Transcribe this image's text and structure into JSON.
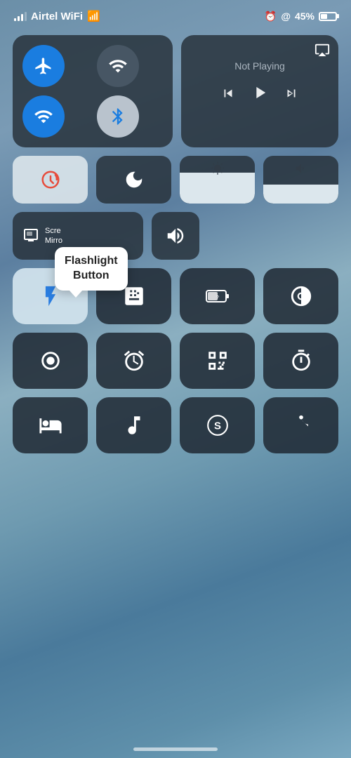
{
  "statusBar": {
    "carrier": "Airtel WiFi",
    "battery": "45%",
    "alarmIcon": "⏰",
    "locationIcon": "@"
  },
  "connectivity": {
    "airplane": {
      "active": true,
      "label": "Airplane Mode"
    },
    "cellular": {
      "active": false,
      "label": "Cellular Data"
    },
    "wifi": {
      "active": true,
      "label": "Wi-Fi"
    },
    "bluetooth": {
      "active": false,
      "label": "Bluetooth"
    }
  },
  "nowPlaying": {
    "title": "Not Playing",
    "airplayLabel": "AirPlay"
  },
  "mediaControls": {
    "previous": "⏮",
    "play": "▶",
    "next": "⏭"
  },
  "utilityRow": {
    "screenLock": "Screen Lock",
    "doNotDisturb": "Do Not Disturb",
    "brightness": "Brightness",
    "volume": "Volume"
  },
  "screenMirror": {
    "label": "Screen\nMirror"
  },
  "iconGrid1": [
    {
      "id": "flashlight",
      "label": "Flashlight",
      "active": true
    },
    {
      "id": "calculator",
      "label": "Calculator",
      "active": false
    },
    {
      "id": "battery-case",
      "label": "Battery Case",
      "active": false
    },
    {
      "id": "grayscale",
      "label": "Grayscale",
      "active": false
    }
  ],
  "iconGrid2": [
    {
      "id": "screen-record",
      "label": "Screen Record",
      "active": false
    },
    {
      "id": "alarm",
      "label": "Alarm",
      "active": false
    },
    {
      "id": "qr-scan",
      "label": "QR Scanner",
      "active": false
    },
    {
      "id": "timer",
      "label": "Timer",
      "active": false
    }
  ],
  "iconGrid3": [
    {
      "id": "sleep",
      "label": "Sleep",
      "active": false
    },
    {
      "id": "shazam",
      "label": "Shazam",
      "active": false
    },
    {
      "id": "music-recognition",
      "label": "Music Recognition",
      "active": false
    },
    {
      "id": "accessibility",
      "label": "Accessibility",
      "active": false
    }
  ],
  "tooltip": {
    "text": "Flashlight\nButton"
  },
  "homeIndicator": "─"
}
